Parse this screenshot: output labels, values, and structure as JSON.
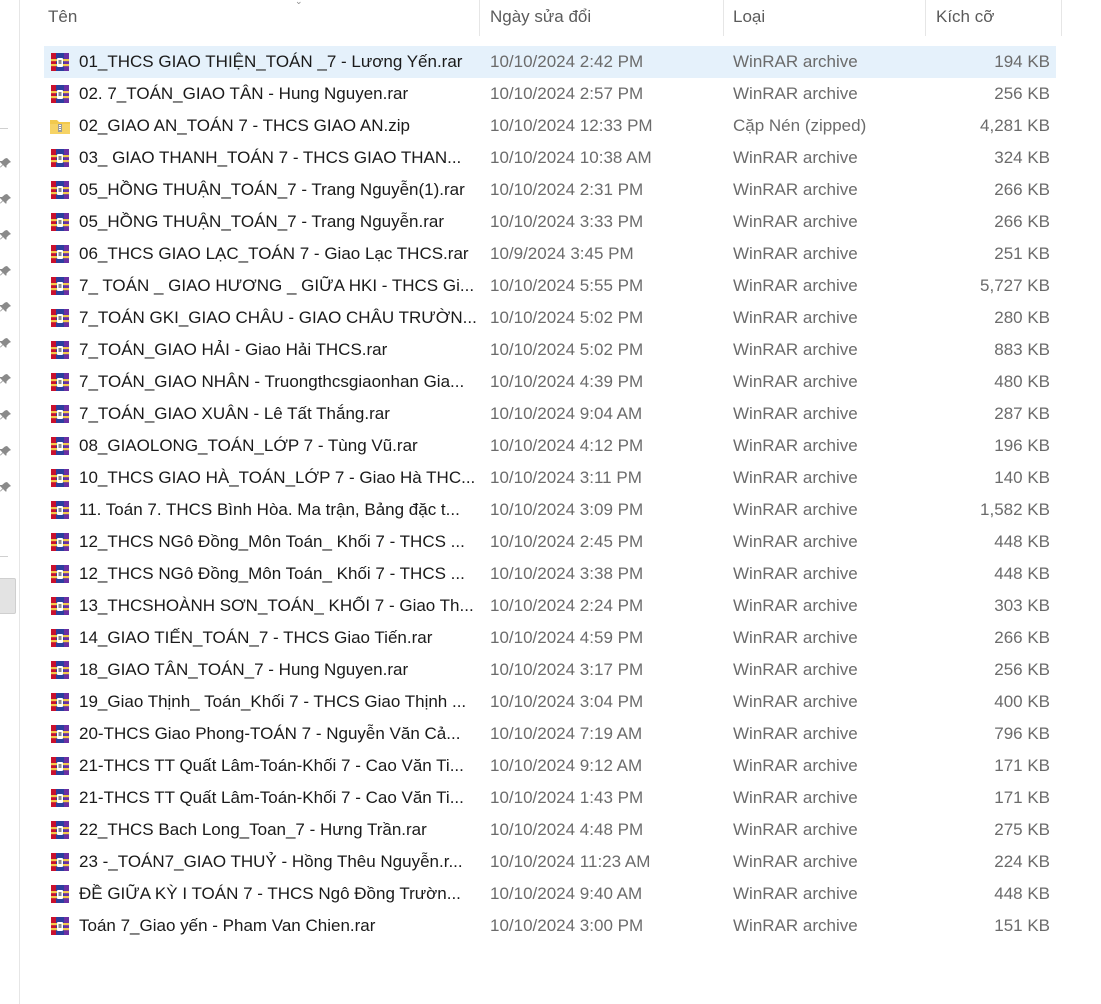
{
  "columns": {
    "name": "Tên",
    "date": "Ngày sửa đổi",
    "type": "Loại",
    "size": "Kích cỡ"
  },
  "files": [
    {
      "name": "01_THCS GIAO THIỆN_TOÁN _7 - Lương Yến.rar",
      "date": "10/10/2024 2:42 PM",
      "type": "WinRAR archive",
      "size": "194 KB",
      "icon": "winrar-icon",
      "selected": true
    },
    {
      "name": "02. 7_TOÁN_GIAO TÂN - Hung Nguyen.rar",
      "date": "10/10/2024 2:57 PM",
      "type": "WinRAR archive",
      "size": "256 KB",
      "icon": "winrar-icon"
    },
    {
      "name": "02_GIAO AN_TOÁN 7 - THCS GIAO AN.zip",
      "date": "10/10/2024 12:33 PM",
      "type": "Cặp Nén (zipped)",
      "size": "4,281 KB",
      "icon": "zip-folder-icon"
    },
    {
      "name": "03_ GIAO THANH_TOÁN 7 - THCS GIAO THAN...",
      "date": "10/10/2024 10:38 AM",
      "type": "WinRAR archive",
      "size": "324 KB",
      "icon": "winrar-icon"
    },
    {
      "name": "05_HỒNG THUẬN_TOÁN_7 - Trang Nguyễn(1).rar",
      "date": "10/10/2024 2:31 PM",
      "type": "WinRAR archive",
      "size": "266 KB",
      "icon": "winrar-icon"
    },
    {
      "name": "05_HỒNG THUẬN_TOÁN_7 - Trang Nguyễn.rar",
      "date": "10/10/2024 3:33 PM",
      "type": "WinRAR archive",
      "size": "266 KB",
      "icon": "winrar-icon"
    },
    {
      "name": "06_THCS GIAO LẠC_TOÁN 7 - Giao Lạc THCS.rar",
      "date": "10/9/2024 3:45 PM",
      "type": "WinRAR archive",
      "size": "251 KB",
      "icon": "winrar-icon"
    },
    {
      "name": "7_ TOÁN _ GIAO HƯƠNG _ GIỮA HKI - THCS Gi...",
      "date": "10/10/2024 5:55 PM",
      "type": "WinRAR archive",
      "size": "5,727 KB",
      "icon": "winrar-icon"
    },
    {
      "name": "7_TOÁN GKI_GIAO CHÂU - GIAO CHÂU TRƯỜN...",
      "date": "10/10/2024 5:02 PM",
      "type": "WinRAR archive",
      "size": "280 KB",
      "icon": "winrar-icon"
    },
    {
      "name": "7_TOÁN_GIAO HẢI - Giao Hải THCS.rar",
      "date": "10/10/2024 5:02 PM",
      "type": "WinRAR archive",
      "size": "883 KB",
      "icon": "winrar-icon"
    },
    {
      "name": "7_TOÁN_GIAO NHÂN - Truongthcsgiaonhan Gia...",
      "date": "10/10/2024 4:39 PM",
      "type": "WinRAR archive",
      "size": "480 KB",
      "icon": "winrar-icon"
    },
    {
      "name": "7_TOÁN_GIAO XUÂN - Lê Tất Thắng.rar",
      "date": "10/10/2024 9:04 AM",
      "type": "WinRAR archive",
      "size": "287 KB",
      "icon": "winrar-icon"
    },
    {
      "name": "08_GIAOLONG_TOÁN_LỚP 7 - Tùng Vũ.rar",
      "date": "10/10/2024 4:12 PM",
      "type": "WinRAR archive",
      "size": "196 KB",
      "icon": "winrar-icon"
    },
    {
      "name": "10_THCS GIAO HÀ_TOÁN_LỚP 7 - Giao Hà THC...",
      "date": "10/10/2024 3:11 PM",
      "type": "WinRAR archive",
      "size": "140 KB",
      "icon": "winrar-icon"
    },
    {
      "name": "11. Toán 7. THCS Bình Hòa. Ma trận, Bảng đặc t...",
      "date": "10/10/2024 3:09 PM",
      "type": "WinRAR archive",
      "size": "1,582 KB",
      "icon": "winrar-icon"
    },
    {
      "name": "12_THCS NGô Đồng_Môn Toán_ Khối 7 - THCS ...",
      "date": "10/10/2024 2:45 PM",
      "type": "WinRAR archive",
      "size": "448 KB",
      "icon": "winrar-icon"
    },
    {
      "name": "12_THCS NGô Đồng_Môn Toán_ Khối 7 - THCS ...",
      "date": "10/10/2024 3:38 PM",
      "type": "WinRAR archive",
      "size": "448 KB",
      "icon": "winrar-icon"
    },
    {
      "name": "13_THCSHOÀNH SƠN_TOÁN_ KHỐI 7 - Giao Th...",
      "date": "10/10/2024 2:24 PM",
      "type": "WinRAR archive",
      "size": "303 KB",
      "icon": "winrar-icon"
    },
    {
      "name": "14_GIAO TIẾN_TOÁN_7 - THCS Giao Tiến.rar",
      "date": "10/10/2024 4:59 PM",
      "type": "WinRAR archive",
      "size": "266 KB",
      "icon": "winrar-icon"
    },
    {
      "name": "18_GIAO TÂN_TOÁN_7 - Hung Nguyen.rar",
      "date": "10/10/2024 3:17 PM",
      "type": "WinRAR archive",
      "size": "256 KB",
      "icon": "winrar-icon"
    },
    {
      "name": "19_Giao Thịnh_ Toán_Khối 7 - THCS Giao Thịnh ...",
      "date": "10/10/2024 3:04 PM",
      "type": "WinRAR archive",
      "size": "400 KB",
      "icon": "winrar-icon"
    },
    {
      "name": "20-THCS Giao Phong-TOÁN 7 - Nguyễn Văn Cả...",
      "date": "10/10/2024 7:19 AM",
      "type": "WinRAR archive",
      "size": "796 KB",
      "icon": "winrar-icon"
    },
    {
      "name": "21-THCS TT Quất Lâm-Toán-Khối 7 - Cao Văn Ti...",
      "date": "10/10/2024 9:12 AM",
      "type": "WinRAR archive",
      "size": "171 KB",
      "icon": "winrar-icon"
    },
    {
      "name": "21-THCS TT Quất Lâm-Toán-Khối 7 - Cao Văn Ti...",
      "date": "10/10/2024 1:43 PM",
      "type": "WinRAR archive",
      "size": "171 KB",
      "icon": "winrar-icon"
    },
    {
      "name": "22_THCS Bach Long_Toan_7 - Hưng Trần.rar",
      "date": "10/10/2024 4:48 PM",
      "type": "WinRAR archive",
      "size": "275 KB",
      "icon": "winrar-icon"
    },
    {
      "name": "23 -_TOÁN7_GIAO THUỶ - Hồng Thêu Nguyễn.r...",
      "date": "10/10/2024 11:23 AM",
      "type": "WinRAR archive",
      "size": "224 KB",
      "icon": "winrar-icon"
    },
    {
      "name": "ĐỀ GIỮA KỲ I TOÁN 7 - THCS Ngô Đồng Trườn...",
      "date": "10/10/2024 9:40 AM",
      "type": "WinRAR archive",
      "size": "448 KB",
      "icon": "winrar-icon"
    },
    {
      "name": "Toán 7_Giao yến - Pham Van Chien.rar",
      "date": "10/10/2024 3:00 PM",
      "type": "WinRAR archive",
      "size": "151 KB",
      "icon": "winrar-icon"
    }
  ],
  "nav_pane": {
    "pin_icon": "pin-icon",
    "pin_count": 10
  },
  "colors": {
    "selected_row": "#e5f1fb",
    "winrar_red": "#c8102e",
    "winrar_blue": "#2b3f9e",
    "zip_folder": "#f2c94c"
  }
}
